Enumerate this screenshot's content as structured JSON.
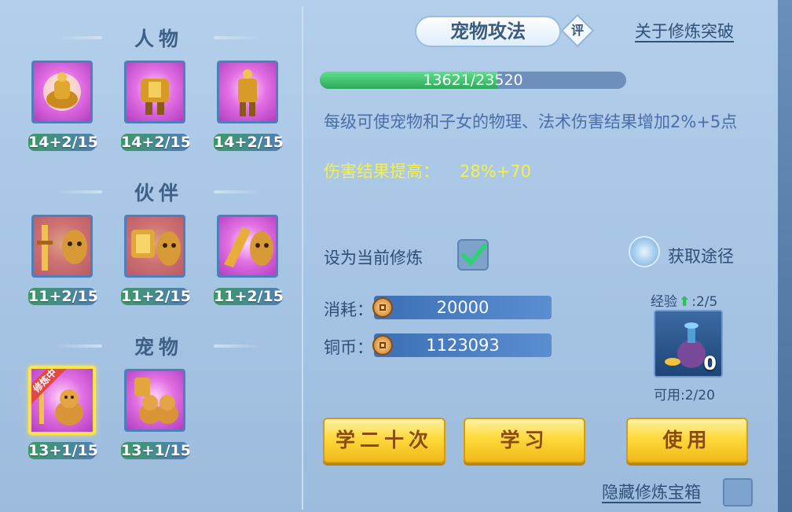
{
  "colors": {
    "accent_yellow": "#f6f04a",
    "desc_blue": "#4a6ea6",
    "exp_green": "#2fa85b",
    "button_gold": "#ffd93a"
  },
  "sections": [
    {
      "title": "人物",
      "slots": [
        {
          "icon": "monk-armor-icon",
          "level": "14+2/15"
        },
        {
          "icon": "shield-armor-icon",
          "level": "14+2/15"
        },
        {
          "icon": "warrior-armor-icon",
          "level": "14+2/15"
        }
      ]
    },
    {
      "title": "伙伴",
      "slots": [
        {
          "icon": "sword-beast-icon",
          "level": "11+2/15"
        },
        {
          "icon": "shield-beast-icon",
          "level": "11+2/15"
        },
        {
          "icon": "claw-beast-icon",
          "level": "11+2/15"
        }
      ]
    },
    {
      "title": "宠物",
      "slots": [
        {
          "icon": "sword-cat-icon",
          "level": "13+1/15",
          "badge": "修炼中"
        },
        {
          "icon": "shield-cat-icon",
          "level": "13+1/15"
        }
      ]
    }
  ],
  "tab": {
    "title": "宠物攻法",
    "rate_label": "评"
  },
  "about_link": "关于修炼突破",
  "exp": {
    "current": 13621,
    "max": 23520,
    "text": "13621/23520"
  },
  "description": "每级可使宠物和子女的物理、法术伤害结果增加2%+5点",
  "effect": {
    "label": "伤害结果提高：",
    "value": "28%+70"
  },
  "set_current": {
    "label": "设为当前修炼",
    "checked": true
  },
  "acquire": {
    "label": "获取途径"
  },
  "cost": {
    "label": "消耗：",
    "value": "20000"
  },
  "copper": {
    "label": "铜币：",
    "value": "1123093"
  },
  "exp_item": {
    "label": "经验",
    "progress": ":2/5",
    "count": "0",
    "available": "可用:2/20"
  },
  "buttons": {
    "learn20": "学二十次",
    "learn": "学习",
    "use": "使用"
  },
  "hide_chest": {
    "label": "隐藏修炼宝箱"
  }
}
